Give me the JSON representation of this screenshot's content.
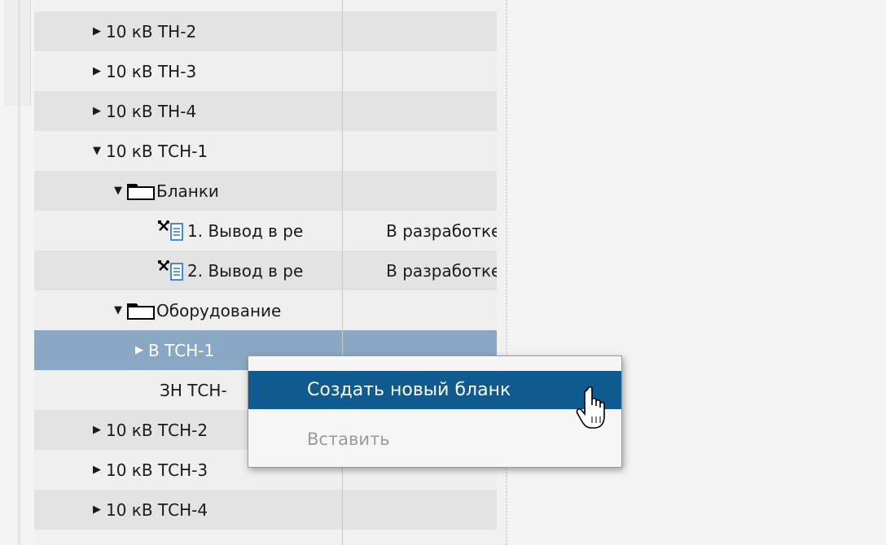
{
  "tree": {
    "rows": [
      {
        "indent": 1,
        "toggle": "▶",
        "icon": "",
        "label": "10 кВ ТН-2",
        "status": "",
        "style": "even"
      },
      {
        "indent": 1,
        "toggle": "▶",
        "icon": "",
        "label": "10 кВ ТН-3",
        "status": "",
        "style": "odd"
      },
      {
        "indent": 1,
        "toggle": "▶",
        "icon": "",
        "label": "10 кВ ТН-4",
        "status": "",
        "style": "even"
      },
      {
        "indent": 1,
        "toggle": "▼",
        "icon": "",
        "label": "10 кВ ТСН-1",
        "status": "",
        "style": "odd"
      },
      {
        "indent": 2,
        "toggle": "▼",
        "icon": "folder-icon",
        "label": "Бланки",
        "status": "",
        "style": "even"
      },
      {
        "indent": 3,
        "toggle": "",
        "icon": "tools-document-icon",
        "label": "1. Вывод в ре",
        "status": "В разработке",
        "style": "odd"
      },
      {
        "indent": 3,
        "toggle": "",
        "icon": "tools-document-icon",
        "label": "2. Вывод в ре",
        "status": "В разработке",
        "style": "even"
      },
      {
        "indent": 2,
        "toggle": "▼",
        "icon": "folder-icon",
        "label": "Оборудование",
        "status": "",
        "style": "odd"
      },
      {
        "indent": 3,
        "toggle": "▶",
        "icon": "",
        "label": "В ТСН-1",
        "status": "",
        "style": "selected"
      },
      {
        "indent": 3,
        "toggle": "",
        "icon": "",
        "label": "ЗН ТСН-",
        "status": "",
        "style": "odd"
      },
      {
        "indent": 1,
        "toggle": "▶",
        "icon": "",
        "label": "10 кВ ТСН-2",
        "status": "",
        "style": "even"
      },
      {
        "indent": 1,
        "toggle": "▶",
        "icon": "",
        "label": "10 кВ ТСН-3",
        "status": "",
        "style": "odd"
      },
      {
        "indent": 1,
        "toggle": "▶",
        "icon": "",
        "label": "10 кВ ТСН-4",
        "status": "",
        "style": "even"
      }
    ]
  },
  "context_menu": {
    "create_label": "Создать новый бланк",
    "paste_label": "Вставить"
  },
  "colors": {
    "selected_row": "#8aa8c3",
    "menu_highlight": "#0f5a8f",
    "disabled_text": "#9a9a9a"
  }
}
